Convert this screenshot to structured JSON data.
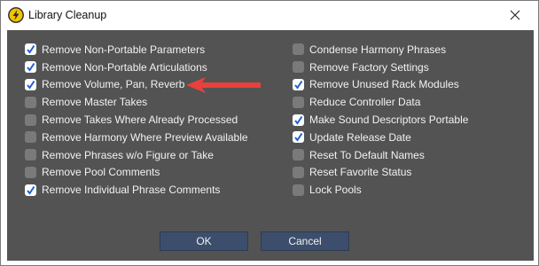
{
  "window": {
    "title": "Library Cleanup",
    "app_icon": "lightning-icon",
    "close_icon": "close-icon"
  },
  "colors": {
    "panel": "#535353",
    "button": "#3c4e6b",
    "check": "#1d5fd6",
    "arrow": "#e8403c"
  },
  "left_options": [
    {
      "label": "Remove Non-Portable Parameters",
      "checked": true
    },
    {
      "label": "Remove Non-Portable Articulations",
      "checked": true
    },
    {
      "label": "Remove Volume, Pan, Reverb",
      "checked": true
    },
    {
      "label": "Remove Master Takes",
      "checked": false
    },
    {
      "label": "Remove Takes Where Already Processed",
      "checked": false
    },
    {
      "label": "Remove Harmony Where Preview Available",
      "checked": false
    },
    {
      "label": "Remove Phrases w/o Figure or Take",
      "checked": false
    },
    {
      "label": "Remove Pool Comments",
      "checked": false
    },
    {
      "label": "Remove Individual Phrase Comments",
      "checked": true
    }
  ],
  "right_options": [
    {
      "label": "Condense Harmony Phrases",
      "checked": false
    },
    {
      "label": "Remove Factory Settings",
      "checked": false
    },
    {
      "label": "Remove Unused Rack Modules",
      "checked": true
    },
    {
      "label": "Reduce Controller Data",
      "checked": false
    },
    {
      "label": "Make Sound Descriptors Portable",
      "checked": true
    },
    {
      "label": "Update Release Date",
      "checked": true
    },
    {
      "label": "Reset To Default Names",
      "checked": false
    },
    {
      "label": "Reset Favorite Status",
      "checked": false
    },
    {
      "label": "Lock Pools",
      "checked": false
    }
  ],
  "buttons": {
    "ok": "OK",
    "cancel": "Cancel"
  }
}
